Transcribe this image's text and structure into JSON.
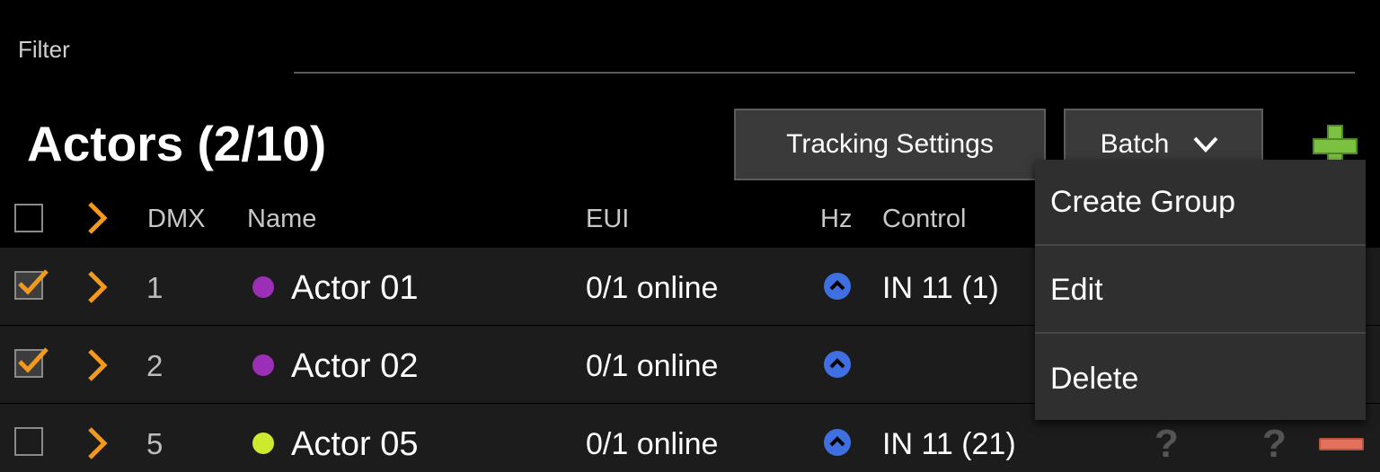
{
  "filter": {
    "label": "Filter",
    "value": ""
  },
  "title": "Actors (2/10)",
  "toolbar": {
    "tracking_settings_label": "Tracking Settings",
    "batch_label": "Batch",
    "add_icon": "plus-icon"
  },
  "table": {
    "columns": [
      "DMX",
      "Name",
      "EUI",
      "Hz",
      "Control"
    ],
    "rows": [
      {
        "checked": true,
        "dmx": "1",
        "name": "Actor 01",
        "color": "#9b2fb8",
        "eui": "0/1 online",
        "hz_icon": "chevron-up-circle-icon",
        "control": "IN 11 (1)"
      },
      {
        "checked": true,
        "dmx": "2",
        "name": "Actor 02",
        "color": "#9b2fb8",
        "eui": "0/1 online",
        "hz_icon": "chevron-up-circle-icon",
        "control": ""
      },
      {
        "checked": false,
        "dmx": "5",
        "name": "Actor 05",
        "color": "#cdea2e",
        "eui": "0/1 online",
        "hz_icon": "chevron-up-circle-icon",
        "control": "IN 11 (21)",
        "extra_1": "?",
        "extra_2": "?"
      }
    ]
  },
  "batch_menu": {
    "items": [
      "Create Group",
      "Edit",
      "Delete"
    ]
  },
  "colors": {
    "accent_orange": "#f39a1d",
    "hz_blue": "#3f6fe0",
    "add_green": "#7dc142",
    "delete_red": "#e2725b"
  }
}
